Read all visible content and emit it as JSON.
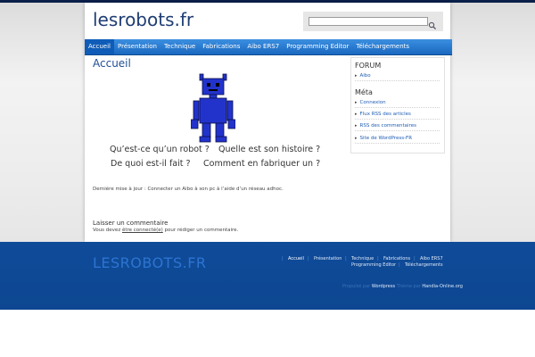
{
  "site": {
    "title": "lesrobots.fr",
    "footer_logo": "LESROBOTS.FR"
  },
  "search": {
    "placeholder": "",
    "value": ""
  },
  "nav": {
    "items": [
      "Accueil",
      "Présentation",
      "Technique",
      "Fabrications",
      "Aibo ERS7",
      "Programming Editor",
      "Téléchargements"
    ],
    "active": "Accueil"
  },
  "main": {
    "title": "Accueil",
    "questions": [
      "Qu’est-ce qu’un robot ?",
      "Quelle est son histoire ?",
      "De quoi est-il fait ?",
      "Comment en fabriquer un ?"
    ],
    "last_update": "Dernière mise à jour : Connecter un Aibo à son pc à l’aide d’un réseau adhoc.",
    "comment_title": "Laisser un commentaire",
    "comment_pre": "Vous devez ",
    "comment_link": "être connecté(e)",
    "comment_post": " pour rédiger un commentaire."
  },
  "sidebar": {
    "forum_heading": "FORUM",
    "forum_items": [
      "Aibo"
    ],
    "meta_heading": "Méta",
    "meta_items": [
      "Connexion",
      "Flux RSS des articles",
      "RSS des commentaires",
      "Site de WordPress-FR"
    ]
  },
  "footer": {
    "nav_row1": [
      "Accueil",
      "Présentation",
      "Technique",
      "Fabrications",
      "Aibo ERS7"
    ],
    "nav_row2": [
      "Programming Editor",
      "Téléchargements"
    ],
    "credit_prefix": "Propulsé par",
    "credit_wp": "Wordpress",
    "credit_mid": "Thème par",
    "credit_author": "Handia-Online.org"
  },
  "colors": {
    "accent": "#1a68c0",
    "footer_bg": "#0f4b99",
    "title": "#1f3d73",
    "robot": "#2233cc"
  },
  "icons": {
    "search": "search-icon",
    "robot": "robot-illustration"
  }
}
